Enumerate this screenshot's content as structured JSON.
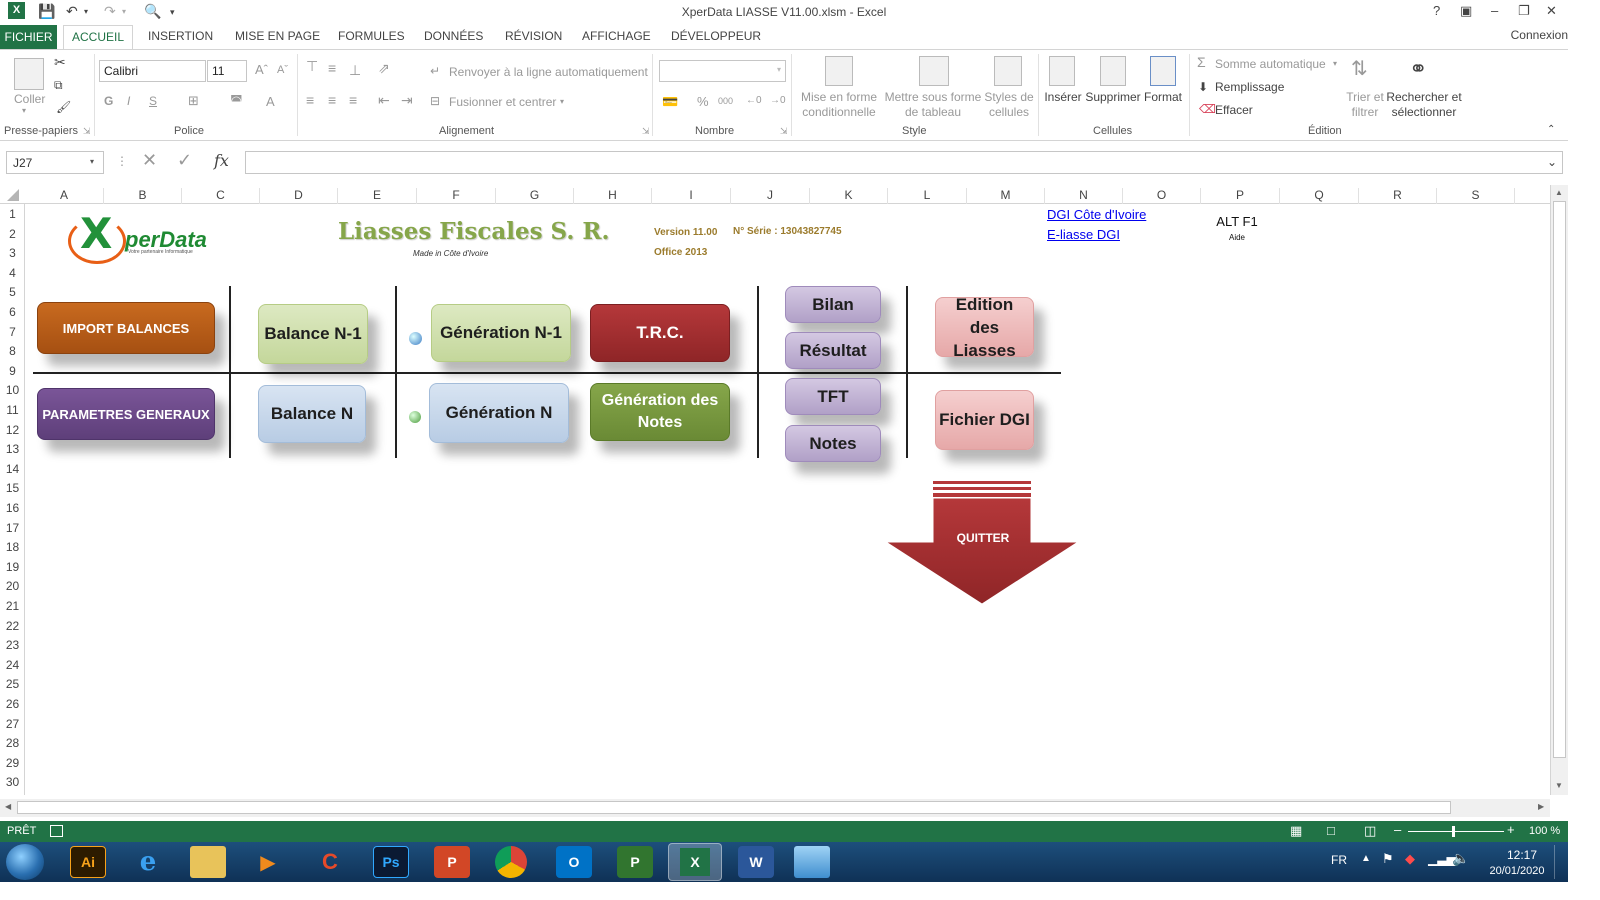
{
  "window": {
    "title": "XperData LIASSE V11.00.xlsm - Excel",
    "help": "?",
    "connexion": "Connexion"
  },
  "tabs": [
    "FICHIER",
    "ACCUEIL",
    "INSERTION",
    "MISE EN PAGE",
    "FORMULES",
    "DONNÉES",
    "RÉVISION",
    "AFFICHAGE",
    "DÉVELOPPEUR"
  ],
  "ribbon": {
    "clipboard": {
      "paste": "Coller",
      "group": "Presse-papiers"
    },
    "font": {
      "name": "Calibri",
      "size": "11",
      "bold": "G",
      "italic": "I",
      "underline": "S",
      "group": "Police"
    },
    "alignment": {
      "wrap": "Renvoyer à la ligne automatiquement",
      "merge": "Fusionner et centrer",
      "group": "Alignement"
    },
    "number": {
      "percent": "%",
      "thousands": "000",
      "group": "Nombre"
    },
    "style": {
      "conditional": "Mise en forme conditionnelle",
      "table": "Mettre sous forme de tableau",
      "cell": "Styles de cellules",
      "group": "Style"
    },
    "cells": {
      "insert": "Insérer",
      "delete": "Supprimer",
      "format": "Format",
      "group": "Cellules"
    },
    "editing": {
      "autosum": "Somme automatique",
      "fill": "Remplissage",
      "clear": "Effacer",
      "sort": "Trier et filtrer",
      "find": "Rechercher et sélectionner",
      "group": "Édition"
    }
  },
  "formula": {
    "namebox": "J27",
    "value": ""
  },
  "columns": [
    "A",
    "B",
    "C",
    "D",
    "E",
    "F",
    "G",
    "H",
    "I",
    "J",
    "K",
    "L",
    "M",
    "N",
    "O",
    "P",
    "Q",
    "R",
    "S"
  ],
  "rows": [
    "1",
    "2",
    "3",
    "4",
    "5",
    "6",
    "7",
    "8",
    "9",
    "10",
    "11",
    "12",
    "13",
    "14",
    "15",
    "16",
    "17",
    "18",
    "19",
    "20",
    "21",
    "22",
    "23",
    "24",
    "25",
    "26",
    "27",
    "28",
    "29",
    "30"
  ],
  "sheet": {
    "logo_text": "perData",
    "logo_tagline": "Votre partenaire Informatique",
    "title": "Liasses Fiscales S. R.",
    "made_in": "Made in Côte d'Ivoire",
    "version": "Version 11.00",
    "serial": "N° Série : 13043827745",
    "office": "Office 2013",
    "link1": "DGI Côte d'Ivoire",
    "link2": "E-liasse DGI",
    "shortcut": "ALT F1",
    "shortcut_sub": "Aide",
    "buttons": {
      "import": "IMPORT BALANCES",
      "params": "PARAMETRES GENERAUX",
      "bal_n1": "Balance N-1",
      "bal_n": "Balance N",
      "gen_n1": "Génération N-1",
      "gen_n": "Génération N",
      "trc": "T.R.C.",
      "gen_notes": "Génération des Notes",
      "bilan": "Bilan",
      "resultat": "Résultat",
      "tft": "TFT",
      "notes": "Notes",
      "edition": "Edition des Liasses",
      "fichier": "Fichier DGI",
      "quitter": "QUITTER"
    }
  },
  "status": {
    "ready": "PRÊT",
    "zoom": "100 %"
  },
  "taskbar": {
    "lang": "FR",
    "time": "12:17",
    "date": "20/01/2020"
  },
  "colors": {
    "excel_green": "#217346",
    "taskbar": "#1d4f7c"
  }
}
